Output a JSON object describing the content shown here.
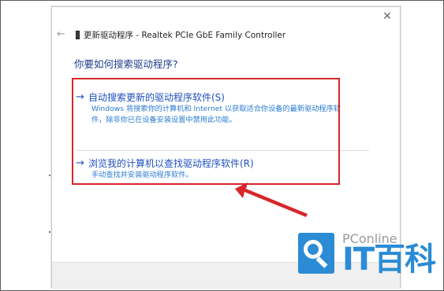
{
  "window": {
    "title": "更新驱动程序 - Realtek PCIe GbE Family Controller",
    "close_glyph": "✕",
    "back_glyph": "←"
  },
  "question": "你要如何搜索驱动程序?",
  "options": [
    {
      "label": "自动搜索更新的驱动程序软件(S)",
      "description_lines": [
        "Windows 将搜索你的计算机和 Internet 以获取适合你设备的最新驱动程序软",
        "件，除非你已在设备安装设置中禁用此功能。"
      ]
    },
    {
      "label": "浏览我的计算机以查找驱动程序软件(R)",
      "description_lines": [
        "手动查找并安装驱动程序软件。"
      ]
    }
  ],
  "option_arrow": "→",
  "annotation": {
    "color": "#d7262a"
  },
  "watermark": {
    "small_text": "PConline",
    "big_text": "IT百科",
    "color": "#2b8bd5"
  }
}
